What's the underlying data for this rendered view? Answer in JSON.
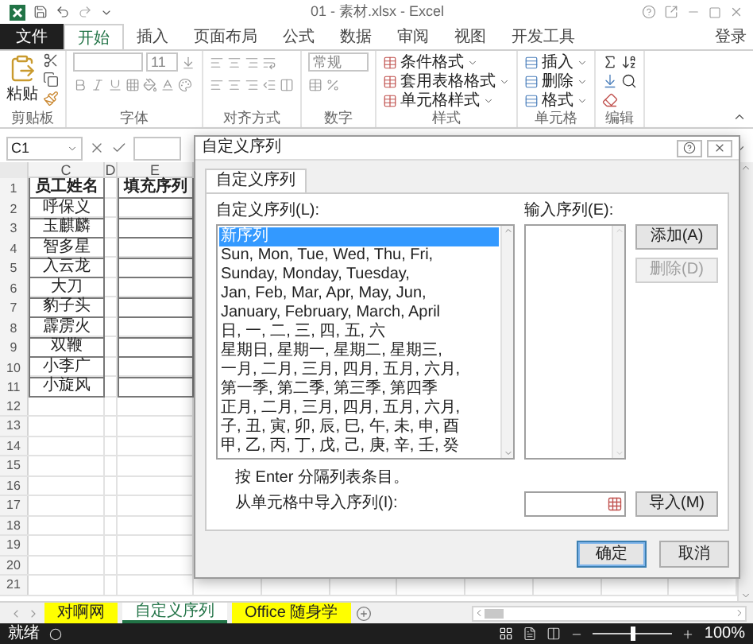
{
  "window": {
    "title": "01 - 素材.xlsx - Excel"
  },
  "ribbon_tabs": [
    {
      "label": "文件",
      "kind": "file",
      "selected": false
    },
    {
      "label": "开始",
      "kind": "tab",
      "selected": true
    },
    {
      "label": "插入",
      "kind": "tab",
      "selected": false
    },
    {
      "label": "页面布局",
      "kind": "tab",
      "selected": false
    },
    {
      "label": "公式",
      "kind": "tab",
      "selected": false
    },
    {
      "label": "数据",
      "kind": "tab",
      "selected": false
    },
    {
      "label": "审阅",
      "kind": "tab",
      "selected": false
    },
    {
      "label": "视图",
      "kind": "tab",
      "selected": false
    },
    {
      "label": "开发工具",
      "kind": "tab",
      "selected": false
    }
  ],
  "sign_in": "登录",
  "ribbon": {
    "clipboard": {
      "paste": "粘贴",
      "label": "剪贴板"
    },
    "font": {
      "size": "11",
      "label": "字体"
    },
    "alignment": {
      "label": "对齐方式"
    },
    "number": {
      "format": "常规",
      "label": "数字"
    },
    "styles": {
      "items": [
        "条件格式",
        "套用表格格式",
        "单元格样式"
      ],
      "label": "样式"
    },
    "cells": {
      "items": [
        "插入",
        "删除",
        "格式"
      ],
      "label": "单元格"
    },
    "editing": {
      "label": "编辑"
    }
  },
  "formula_bar": {
    "name_box": "C1"
  },
  "sheet": {
    "columns": [
      "C",
      "D",
      "E"
    ],
    "rows": [
      {
        "number": "1",
        "kind": "header",
        "name": "员工姓名",
        "fill": "填充序列"
      },
      {
        "number": "2",
        "kind": "data",
        "name": "呼保义"
      },
      {
        "number": "3",
        "kind": "data",
        "name": "玉麒麟"
      },
      {
        "number": "4",
        "kind": "data",
        "name": "智多星"
      },
      {
        "number": "5",
        "kind": "data",
        "name": "入云龙"
      },
      {
        "number": "6",
        "kind": "data",
        "name": "大刀"
      },
      {
        "number": "7",
        "kind": "data",
        "name": "豹子头"
      },
      {
        "number": "8",
        "kind": "data",
        "name": "霹雳火"
      },
      {
        "number": "9",
        "kind": "data",
        "name": "双鞭"
      },
      {
        "number": "10",
        "kind": "data",
        "name": "小李广"
      },
      {
        "number": "11",
        "kind": "data",
        "name": "小旋风"
      },
      {
        "number": "12",
        "kind": "empty"
      },
      {
        "number": "13",
        "kind": "empty"
      },
      {
        "number": "14",
        "kind": "empty"
      },
      {
        "number": "15",
        "kind": "empty"
      },
      {
        "number": "16",
        "kind": "empty"
      },
      {
        "number": "17",
        "kind": "empty"
      },
      {
        "number": "18",
        "kind": "empty"
      },
      {
        "number": "19",
        "kind": "empty"
      },
      {
        "number": "20",
        "kind": "empty"
      },
      {
        "number": "21",
        "kind": "empty"
      }
    ]
  },
  "dialog": {
    "title": "自定义序列",
    "tabs": [
      {
        "label": "自定义序列",
        "selected": true
      }
    ],
    "list_label": "自定义序列(L):",
    "list": [
      {
        "text": "新序列",
        "selected": true
      },
      {
        "text": "Sun, Mon, Tue, Wed, Thu, Fri,",
        "selected": false
      },
      {
        "text": "Sunday, Monday, Tuesday,",
        "selected": false
      },
      {
        "text": "Jan, Feb, Mar, Apr, May, Jun,",
        "selected": false
      },
      {
        "text": "January, February, March, April",
        "selected": false
      },
      {
        "text": "日, 一, 二, 三, 四, 五, 六",
        "selected": false
      },
      {
        "text": "星期日, 星期一, 星期二, 星期三,",
        "selected": false
      },
      {
        "text": "一月, 二月, 三月, 四月, 五月, 六月,",
        "selected": false
      },
      {
        "text": "第一季, 第二季, 第三季, 第四季",
        "selected": false
      },
      {
        "text": "正月, 二月, 三月, 四月, 五月, 六月,",
        "selected": false
      },
      {
        "text": "子, 丑, 寅, 卯, 辰, 巳, 午, 未, 申, 酉",
        "selected": false
      },
      {
        "text": "甲, 乙, 丙, 丁, 戊, 己, 庚, 辛, 壬, 癸",
        "selected": false
      }
    ],
    "entry_label": "输入序列(E):",
    "buttons": [
      {
        "label": "添加(A)",
        "disabled": false
      },
      {
        "label": "删除(D)",
        "disabled": true
      }
    ],
    "hint": "按 Enter 分隔列表条目。",
    "import_label": "从单元格中导入序列(I):",
    "import_button": "导入(M)",
    "footer": [
      {
        "label": "确定",
        "default": true
      },
      {
        "label": "取消",
        "default": false
      }
    ]
  },
  "sheet_tabs": [
    {
      "label": "对啊网",
      "selected": false,
      "color": "#ffff00"
    },
    {
      "label": "自定义序列",
      "selected": true,
      "color": "#ffffff"
    },
    {
      "label": "Office 随身学",
      "selected": false,
      "color": "#ffff00"
    }
  ],
  "status_bar": {
    "status": "就绪",
    "zoom": {
      "level": 0.5,
      "reading": "100%"
    }
  }
}
